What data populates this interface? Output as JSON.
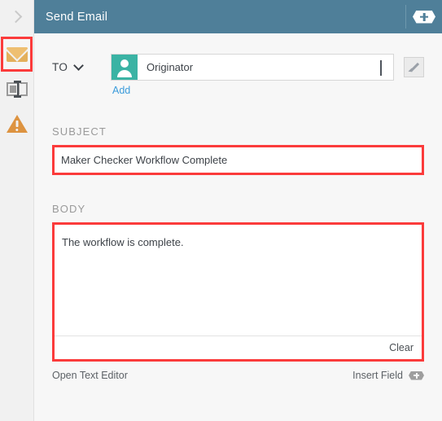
{
  "titlebar": {
    "title": "Send Email",
    "collapse_icon": "chevron-right-icon",
    "add_icon": "plus-hex-icon"
  },
  "sidebar": {
    "items": [
      {
        "name": "email",
        "icon": "envelope-icon",
        "selected": true
      },
      {
        "name": "text-field",
        "icon": "text-field-icon",
        "selected": false
      },
      {
        "name": "warning",
        "icon": "warning-triangle-icon",
        "selected": false
      }
    ]
  },
  "form": {
    "to": {
      "label": "TO",
      "dropdown_icon": "chevron-down-icon",
      "avatar_icon": "person-icon",
      "recipient": "Originator",
      "recipient_dropdown_icon": "chevron-down-icon",
      "add_label": "Add",
      "edit_icon": "pencil-icon"
    },
    "subject": {
      "label": "SUBJECT",
      "value": "Maker Checker Workflow Complete",
      "placeholder": ""
    },
    "body": {
      "label": "BODY",
      "value": "The workflow is complete.",
      "placeholder": "",
      "clear_label": "Clear"
    },
    "footer": {
      "open_editor_label": "Open Text Editor",
      "insert_field_label": "Insert Field",
      "insert_field_icon": "plus-hex-icon"
    }
  },
  "colors": {
    "header_blue": "#4f7f99",
    "highlight_red": "#fb3b3b",
    "avatar_teal": "#3ab3a4",
    "link_blue": "#3b9bdb",
    "envelope_orange": "#e3b05c",
    "warning_orange": "#dd9340",
    "page_bg": "#f7f7f7"
  }
}
